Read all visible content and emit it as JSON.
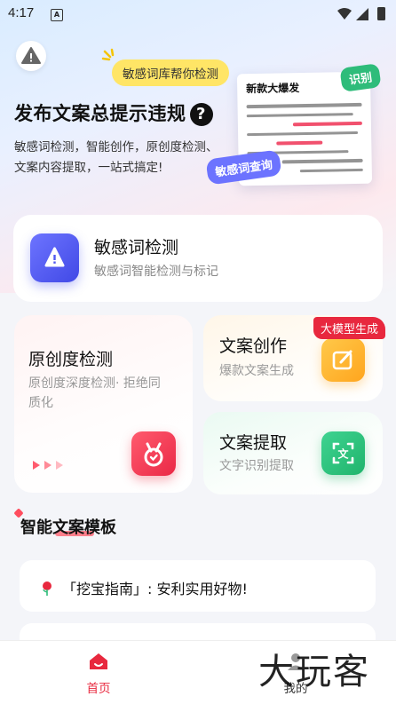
{
  "status_bar": {
    "time": "4:17",
    "notif_icon": "A"
  },
  "hero": {
    "tag_yellow": "敏感词库帮你检测",
    "title": "发布文案总提示违规",
    "title_q": "?",
    "subtitle_1": "敏感词检测，智能创作，原创度检测、",
    "subtitle_2": "文案内容提取，一站式搞定!",
    "paper_title": "新款大爆发",
    "tag_green": "识别",
    "tag_purple": "敏感词查询"
  },
  "features": {
    "sensitive": {
      "title": "敏感词检测",
      "subtitle": "敏感词智能检测与标记"
    },
    "original": {
      "title": "原创度检测",
      "subtitle": "原创度深度检测· 拒绝同质化"
    },
    "write": {
      "title": "文案创作",
      "subtitle": "爆款文案生成",
      "badge": "大模型生成"
    },
    "extract": {
      "title": "文案提取",
      "subtitle": "文字识别提取"
    }
  },
  "templates": {
    "section_title": "智能文案模板",
    "items": [
      {
        "text": "「挖宝指南」: 安利实用好物!"
      }
    ]
  },
  "tabbar": {
    "home": "首页",
    "me": "我的"
  },
  "watermark": "大玩客",
  "colors": {
    "accent_red": "#e8283e",
    "purple": "#4d55f0",
    "yellow": "#ffe566",
    "green": "#2ebc7a"
  }
}
